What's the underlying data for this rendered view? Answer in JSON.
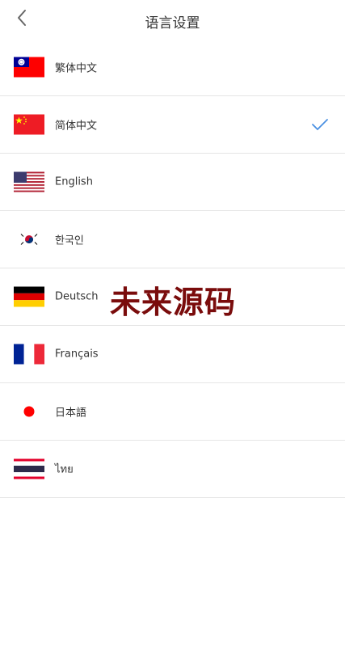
{
  "header": {
    "title": "语言设置",
    "back_icon": "chevron-left-icon"
  },
  "languages": [
    {
      "label": "繁体中文",
      "flag": "taiwan-flag-icon",
      "selected": false
    },
    {
      "label": "简体中文",
      "flag": "china-flag-icon",
      "selected": true
    },
    {
      "label": "English",
      "flag": "usa-flag-icon",
      "selected": false
    },
    {
      "label": "한국인",
      "flag": "korea-flag-icon",
      "selected": false
    },
    {
      "label": "Deutsch",
      "flag": "germany-flag-icon",
      "selected": false
    },
    {
      "label": "Français",
      "flag": "france-flag-icon",
      "selected": false
    },
    {
      "label": "日本語",
      "flag": "japan-flag-icon",
      "selected": false
    },
    {
      "label": "ไทย",
      "flag": "thailand-flag-icon",
      "selected": false
    }
  ],
  "watermark": "未来源码",
  "colors": {
    "check": "#4a90e2",
    "divider": "#e5e5e5",
    "watermark": "#7a0c0c"
  }
}
